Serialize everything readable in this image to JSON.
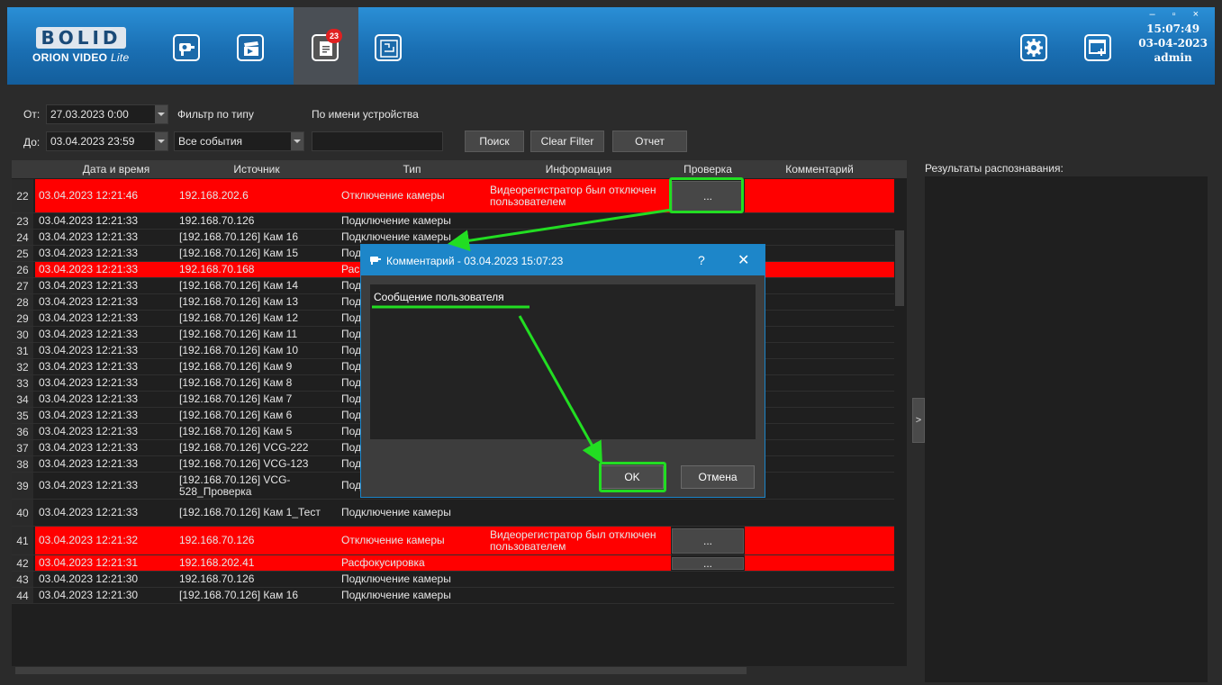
{
  "topbar": {
    "logo_brand": "BOLID",
    "logo_sub": "ORION VIDEO",
    "logo_sub_italic": "Lite",
    "events_badge": "23",
    "window_controls": "–  ▫  ×",
    "time": "15:07:49",
    "date": "03-04-2023",
    "user": "admin",
    "icons": [
      "camera-icon",
      "clapperboard-icon",
      "events-icon",
      "plan-icon",
      "settings-icon",
      "add-window-icon"
    ]
  },
  "filters": {
    "from_label": "От:",
    "from_value": "27.03.2023 0:00",
    "to_label": "До:",
    "to_value": "03.04.2023 23:59",
    "type_filter_label": "Фильтр по типу",
    "type_filter_value": "Все события",
    "device_name_label": "По имени устройства",
    "device_name_value": "",
    "search_button": "Поиск",
    "clear_filter_button": "Clear Filter",
    "report_button": "Отчет"
  },
  "table": {
    "columns": [
      "Дата и время",
      "Источник",
      "Тип",
      "Информация",
      "Проверка",
      "Комментарий"
    ],
    "rows": [
      {
        "num": "22",
        "datetime": "03.04.2023 12:21:46",
        "source": "192.168.202.6",
        "type": "Отключение камеры",
        "info": "Видеорегистратор был отключен пользователем",
        "check": "...",
        "red": true
      },
      {
        "num": "23",
        "datetime": "03.04.2023 12:21:33",
        "source": "192.168.70.126",
        "type": "Подключение камеры",
        "info": "",
        "check": "",
        "red": false
      },
      {
        "num": "24",
        "datetime": "03.04.2023 12:21:33",
        "source": "[192.168.70.126] Кам 16",
        "type": "Подключение камеры",
        "info": "",
        "check": "",
        "red": false
      },
      {
        "num": "25",
        "datetime": "03.04.2023 12:21:33",
        "source": "[192.168.70.126] Кам 15",
        "type": "Под",
        "info": "",
        "check": "",
        "red": false
      },
      {
        "num": "26",
        "datetime": "03.04.2023 12:21:33",
        "source": "192.168.70.168",
        "type": "Рас",
        "info": "",
        "check": "",
        "red": true
      },
      {
        "num": "27",
        "datetime": "03.04.2023 12:21:33",
        "source": "[192.168.70.126] Кам 14",
        "type": "Под",
        "info": "",
        "check": "",
        "red": false
      },
      {
        "num": "28",
        "datetime": "03.04.2023 12:21:33",
        "source": "[192.168.70.126] Кам 13",
        "type": "Под",
        "info": "",
        "check": "",
        "red": false
      },
      {
        "num": "29",
        "datetime": "03.04.2023 12:21:33",
        "source": "[192.168.70.126] Кам 12",
        "type": "Под",
        "info": "",
        "check": "",
        "red": false
      },
      {
        "num": "30",
        "datetime": "03.04.2023 12:21:33",
        "source": "[192.168.70.126] Кам 11",
        "type": "Под",
        "info": "",
        "check": "",
        "red": false
      },
      {
        "num": "31",
        "datetime": "03.04.2023 12:21:33",
        "source": "[192.168.70.126] Кам 10",
        "type": "Под",
        "info": "",
        "check": "",
        "red": false
      },
      {
        "num": "32",
        "datetime": "03.04.2023 12:21:33",
        "source": "[192.168.70.126] Кам 9",
        "type": "Под",
        "info": "",
        "check": "",
        "red": false
      },
      {
        "num": "33",
        "datetime": "03.04.2023 12:21:33",
        "source": "[192.168.70.126] Кам 8",
        "type": "Под",
        "info": "",
        "check": "",
        "red": false
      },
      {
        "num": "34",
        "datetime": "03.04.2023 12:21:33",
        "source": "[192.168.70.126] Кам 7",
        "type": "Под",
        "info": "",
        "check": "",
        "red": false
      },
      {
        "num": "35",
        "datetime": "03.04.2023 12:21:33",
        "source": "[192.168.70.126] Кам 6",
        "type": "Под",
        "info": "",
        "check": "",
        "red": false
      },
      {
        "num": "36",
        "datetime": "03.04.2023 12:21:33",
        "source": "[192.168.70.126] Кам 5",
        "type": "Под",
        "info": "",
        "check": "",
        "red": false
      },
      {
        "num": "37",
        "datetime": "03.04.2023 12:21:33",
        "source": "[192.168.70.126] VCG-222",
        "type": "Под",
        "info": "",
        "check": "",
        "red": false
      },
      {
        "num": "38",
        "datetime": "03.04.2023 12:21:33",
        "source": "[192.168.70.126] VCG-123",
        "type": "Подключение камеры",
        "info": "",
        "check": "",
        "red": false
      },
      {
        "num": "39",
        "datetime": "03.04.2023 12:21:33",
        "source": "[192.168.70.126] VCG-528_Проверка",
        "type": "Подключение камеры",
        "info": "",
        "check": "",
        "red": false
      },
      {
        "num": "40",
        "datetime": "03.04.2023 12:21:33",
        "source": "[192.168.70.126] Кам 1_Тест",
        "type": "Подключение камеры",
        "info": "",
        "check": "",
        "red": false
      },
      {
        "num": "41",
        "datetime": "03.04.2023 12:21:32",
        "source": "192.168.70.126",
        "type": "Отключение камеры",
        "info": "Видеорегистратор был отключен пользователем",
        "check": "...",
        "red": true
      },
      {
        "num": "42",
        "datetime": "03.04.2023 12:21:31",
        "source": "192.168.202.41",
        "type": "Расфокусировка",
        "info": "",
        "check": "...",
        "red": true
      },
      {
        "num": "43",
        "datetime": "03.04.2023 12:21:30",
        "source": "192.168.70.126",
        "type": "Подключение камеры",
        "info": "",
        "check": "",
        "red": false
      },
      {
        "num": "44",
        "datetime": "03.04.2023 12:21:30",
        "source": "[192.168.70.126] Кам 16",
        "type": "Подключение камеры",
        "info": "",
        "check": "",
        "red": false
      }
    ]
  },
  "right_panel": {
    "title": "Результаты распознавания:",
    "collapse_glyph": ">"
  },
  "dialog": {
    "title": "Комментарий - 03.04.2023 15:07:23",
    "help": "?",
    "close": "✕",
    "text": "Сообщение пользователя",
    "ok": "OK",
    "cancel": "Отмена"
  },
  "colors": {
    "accent": "#1d86c9",
    "alarm_row": "#ff0000",
    "annotation": "#22dd22"
  }
}
